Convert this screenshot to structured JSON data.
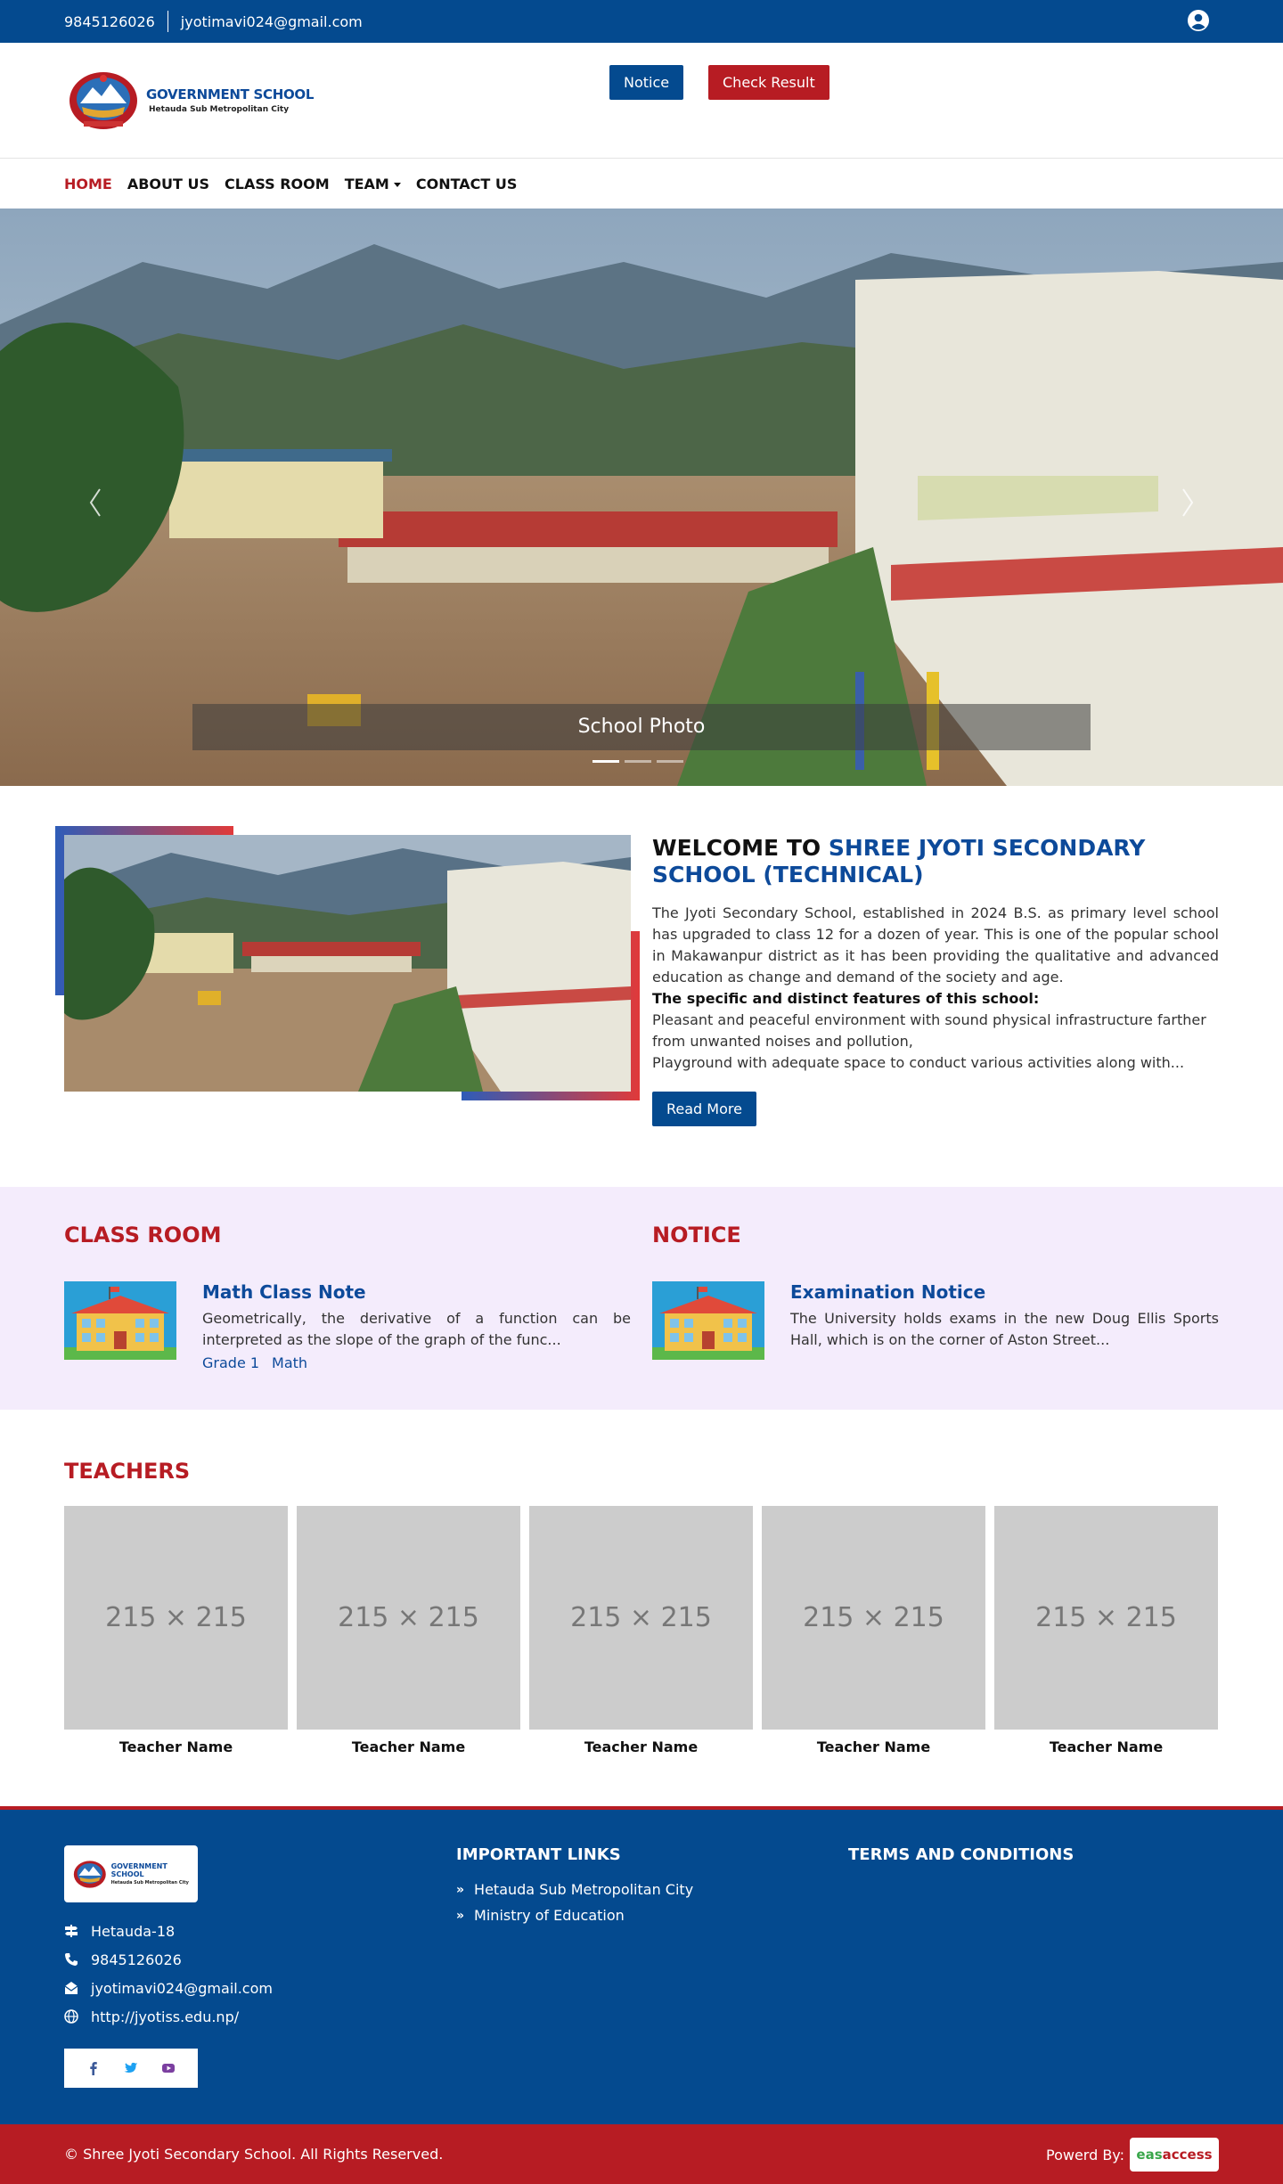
{
  "topbar": {
    "phone": "9845126026",
    "email": "jyotimavi024@gmail.com"
  },
  "header": {
    "logo_title": "GOVERNMENT SCHOOL",
    "logo_subtitle": "Hetauda Sub Metropolitan City",
    "notice_button": "Notice",
    "result_button": "Check Result"
  },
  "nav": {
    "home": "HOME",
    "about": "ABOUT US",
    "classroom": "CLASS ROOM",
    "team": "TEAM",
    "contact": "CONTACT US"
  },
  "hero": {
    "caption": "School Photo",
    "slide_count": 3,
    "active_slide": 1
  },
  "welcome": {
    "heading_prefix": "WELCOME TO ",
    "heading_name": "SHREE JYOTI SECONDARY SCHOOL (TECHNICAL)",
    "intro": "The Jyoti Secondary School, established in 2024 B.S. as primary level school has upgraded to class 12 for a dozen of year. This is one of the popular school in Makawanpur district as it has been providing the qualitative and advanced education as change and demand of the society and age.",
    "features_heading": "The specific and distinct features of this school:",
    "feature1": "Pleasant and peaceful environment with sound physical infrastructure farther from unwanted noises and pollution,",
    "feature2": "Playground with adequate space to  conduct various activities along with...",
    "read_more": "Read More"
  },
  "classroom": {
    "heading": "CLASS ROOM",
    "item_title": "Math Class Note",
    "item_text": "Geometrically, the derivative of a function can be interpreted as the slope of the graph of the func...",
    "tag_grade": "Grade 1",
    "tag_subject": "Math"
  },
  "notice": {
    "heading": "NOTICE",
    "item_title": "Examination Notice",
    "item_text": "The University holds exams in the new Doug Ellis Sports Hall, which is on the corner of Aston Street..."
  },
  "teachers": {
    "heading": "TEACHERS",
    "placeholder": "215 × 215",
    "names": [
      "Teacher Name",
      "Teacher Name",
      "Teacher Name",
      "Teacher Name",
      "Teacher Name"
    ]
  },
  "footer": {
    "address": "Hetauda-18",
    "phone": "9845126026",
    "email": "jyotimavi024@gmail.com",
    "website": "http://jyotiss.edu.np/",
    "links_heading": "IMPORTANT LINKS",
    "link1": "Hetauda Sub Metropolitan City",
    "link2": "Ministry of Education",
    "terms_heading": "TERMS AND CONDITIONS",
    "copyright": "© Shree Jyoti Secondary School. All Rights Reserved.",
    "powered_by": "Powerd By:",
    "brand_a": "eas",
    "brand_b": "access"
  },
  "colors": {
    "primary": "#044a8f",
    "accent": "#b71c23",
    "band": "#f4ecfc"
  }
}
